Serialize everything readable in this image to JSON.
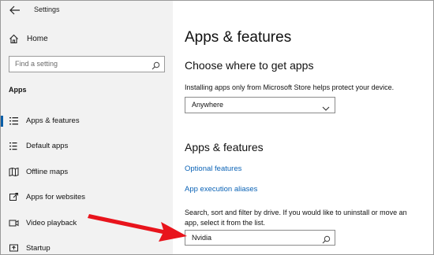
{
  "window": {
    "title": "Settings"
  },
  "sidebar": {
    "home_label": "Home",
    "search_placeholder": "Find a setting",
    "section_label": "Apps",
    "items": [
      {
        "label": "Apps & features",
        "icon": "list-icon",
        "active": true
      },
      {
        "label": "Default apps",
        "icon": "default-apps-icon",
        "active": false
      },
      {
        "label": "Offline maps",
        "icon": "map-icon",
        "active": false
      },
      {
        "label": "Apps for websites",
        "icon": "open-in-app-icon",
        "active": false
      },
      {
        "label": "Video playback",
        "icon": "video-icon",
        "active": false
      },
      {
        "label": "Startup",
        "icon": "startup-icon",
        "active": false
      }
    ]
  },
  "main": {
    "page_title": "Apps & features",
    "choose_heading": "Choose where to get apps",
    "choose_desc": "Installing apps only from Microsoft Store helps protect your device.",
    "source_dropdown": {
      "value": "Anywhere"
    },
    "apps_heading": "Apps & features",
    "links": {
      "optional_features": "Optional features",
      "execution_aliases": "App execution aliases"
    },
    "filter_desc": "Search, sort and filter by drive. If you would like to uninstall or move an app, select it from the list.",
    "filter_input": {
      "value": "Nvidia"
    }
  },
  "colors": {
    "sidebar_bg": "#f2f2f2",
    "accent": "#0a5ea8",
    "link": "#0b63b6",
    "annotation_arrow": "#e8141c"
  }
}
